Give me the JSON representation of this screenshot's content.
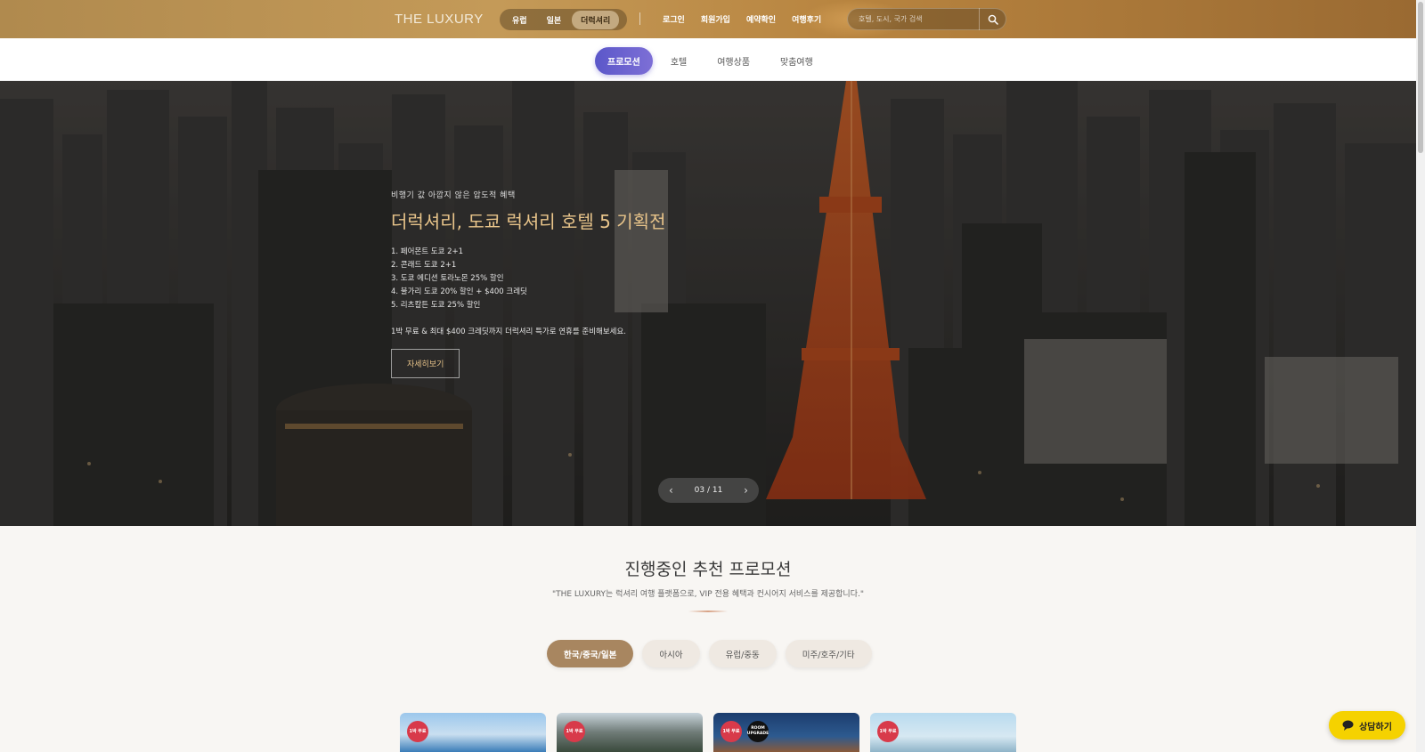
{
  "header": {
    "logo": "THE LUXURY",
    "regions": [
      "유럽",
      "일본",
      "더럭셔리"
    ],
    "active_region": 2,
    "auth_links": [
      "로그인",
      "회원가입",
      "예약확인",
      "여행후기"
    ],
    "search_placeholder": "호텔, 도시, 국가 검색"
  },
  "subnav": {
    "tabs": [
      "프로모션",
      "호텔",
      "여행상품",
      "맞춤여행"
    ],
    "active_tab": 0
  },
  "hero": {
    "eyebrow": "비행기 값 아깝지 않은 압도적 혜택",
    "title": "더럭셔리, 도쿄 럭셔리 호텔 5 기획전",
    "list": [
      "1. 페어몬트 도쿄 2+1",
      "2. 콘래드 도쿄 2+1",
      "3. 도쿄 에디션 토라노몬 25% 할인",
      "4. 불가리 도쿄 20% 할인 + $400 크레딧",
      "5. 리츠칼튼 도쿄 25% 할인"
    ],
    "desc": "1박 무료 & 최대 $400 크레딧까지 더럭셔리 특가로 연휴를 준비해보세요.",
    "cta": "자세히보기",
    "pager": "03 / 11"
  },
  "promo": {
    "title": "진행중인 추천 프로모션",
    "subtitle": "\"THE LUXURY는 럭셔리 여행 플랫폼으로, VIP 전용 혜택과 컨시어지 서비스를 제공합니다.\"",
    "region_tabs": [
      "한국/중국/일본",
      "아시아",
      "유럽/중동",
      "미주/호주/기타"
    ],
    "active_region_tab": 0,
    "cards": [
      {
        "badge": "1박 무료",
        "badge2": ""
      },
      {
        "badge": "1박 무료",
        "badge2": ""
      },
      {
        "badge": "1박 무료",
        "badge2": "ROOM UPGRADE"
      },
      {
        "badge": "1박 무료",
        "badge2": ""
      }
    ]
  },
  "chat": {
    "label": "상담하기"
  },
  "colors": {
    "accent": "#a88660",
    "promo_tab": "#6a63d0",
    "badge": "#d83a4a",
    "chat": "#f5d200"
  }
}
